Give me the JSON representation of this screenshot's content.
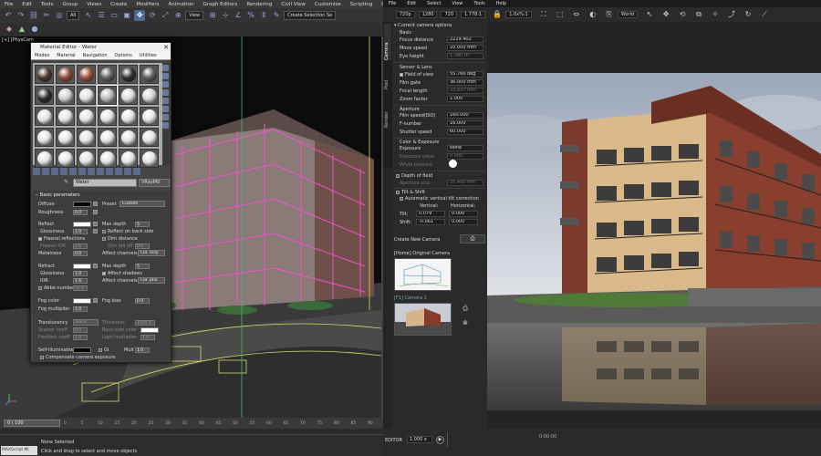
{
  "max": {
    "menu": [
      "File",
      "Edit",
      "Tools",
      "Group",
      "Views",
      "Create",
      "Modifiers",
      "Animation",
      "Graph Editors",
      "Rendering",
      "Civil View",
      "Customize",
      "Scripting",
      "Interactive"
    ],
    "toolbar": {
      "filter": "All",
      "ref_coord": "View",
      "selection_set": "Create Selection Se"
    },
    "viewport_label": "[+] [PhysCam",
    "timeline": {
      "frame": "0 / 100"
    },
    "ticks": [
      "0",
      "5",
      "10",
      "15",
      "20",
      "25",
      "30",
      "35",
      "40",
      "45",
      "50",
      "55",
      "60",
      "65",
      "70",
      "75",
      "80",
      "85",
      "90"
    ],
    "status": {
      "script": "MAXScript Mi",
      "selection": "None Selected",
      "hint": "Click and drag to select and move objects"
    }
  },
  "material_editor": {
    "title": "Material Editor - Water",
    "menu": [
      "Modes",
      "Material",
      "Navigation",
      "Options",
      "Utilities"
    ],
    "name": "Water",
    "type": "VRayMtl",
    "rollout": "Basic parameters",
    "labels": {
      "diffuse": "Diffuse",
      "roughness": "Roughness",
      "preset": "Preset",
      "preset_value": "Custom",
      "reflect": "Reflect",
      "glossiness": "Glossiness",
      "fresnel": "Fresnel reflections",
      "fresnel_ior": "Fresnel IOR",
      "metalness": "Metalness",
      "max_depth": "Max depth",
      "reflect_back": "Reflect on back side",
      "dim_distance": "Dim distance",
      "dim_falloff": "Dim fall off",
      "affect_channels": "Affect channels",
      "refract": "Refract",
      "ior": "IOR",
      "abbe": "Abbe number",
      "affect_shadows": "Affect shadows",
      "fog_color": "Fog color",
      "fog_bias": "Fog bias",
      "fog_mult": "Fog multiplier",
      "translucency": "Translucency",
      "translucency_value": "None",
      "scatter_coeff": "Scatter coeff",
      "fwd_bck": "Fwd/bck coeff",
      "thickness": "Thickness",
      "back_side_color": "Back-side color",
      "light_mult": "Light multiplier",
      "self_illum": "Self-illumination",
      "gi": "GI",
      "mult": "Mult",
      "compensate": "Compensate camera exposure"
    },
    "values": {
      "roughness": "0.0",
      "reflect_gloss": "1.0",
      "fresnel_ior": "1.6",
      "metalness": "0.0",
      "max_depth": "5",
      "dim_falloff": "0.0",
      "affect_channels": "Col. only",
      "refract_gloss": "1.0",
      "ior": "1.6",
      "abbe": "50.0",
      "refract_max_depth": "5",
      "affect_channels2": "Col. pha",
      "fog_bias": "0.0",
      "fog_mult": "1.0",
      "scatter": "0.0",
      "fwdbck": "1.0",
      "thickness": "1000.0",
      "light_mult": "1.0",
      "mult": "1.0"
    }
  },
  "vfb": {
    "menu": [
      "File",
      "Edit",
      "Select",
      "View",
      "Tools",
      "Help"
    ],
    "toolbar": {
      "res": "720p",
      "w": "1280",
      "h": "720",
      "aspect": "1.778:1",
      "zoom": "1.0x%:1",
      "space": "World"
    },
    "tabs": [
      "Camera",
      "Post",
      "Render"
    ],
    "panel": {
      "current": "Current camera options",
      "basic": "Basic",
      "focus_distance": {
        "label": "Focus distance",
        "value": "2229.402"
      },
      "move_speed": {
        "label": "Move speed",
        "value": "10.000 mm"
      },
      "eye_height": {
        "label": "Eye height",
        "value": "1.380 m"
      },
      "sensor": "Sensor & Lens",
      "fov": {
        "label": "Field of view",
        "value": "55.766 deg"
      },
      "film_gate": {
        "label": "Film gate",
        "value": "36.000 mm"
      },
      "focal_length": {
        "label": "Focal length",
        "value": "33.837 mm"
      },
      "zoom_factor": {
        "label": "Zoom factor",
        "value": "1.000"
      },
      "aperture": "Aperture",
      "film_speed": {
        "label": "Film speed(ISO)",
        "value": "160.000"
      },
      "fnumber": {
        "label": "F-number",
        "value": "16.000"
      },
      "shutter": {
        "label": "Shutter speed",
        "value": "60.000"
      },
      "color_exposure": "Color & Exposure",
      "exposure": {
        "label": "Exposure",
        "value": "None"
      },
      "exposure_value": {
        "label": "Exposure value",
        "value": "0.000"
      },
      "white_balance": {
        "label": "White balance"
      },
      "dof": "Depth of field",
      "aperture_size": {
        "label": "Aperture size",
        "value": "25.400 mm"
      },
      "tilt_shift": "Tilt & Shift",
      "auto_tilt": "Automatic vertical tilt correction",
      "vertical": "Vertical:",
      "horizontal": "Horizontal:",
      "tilt": {
        "label": "Tilt:",
        "v": "0.079",
        "h": "0.000"
      },
      "shift": {
        "label": "Shift:",
        "v": "-0.061",
        "h": "0.000"
      },
      "create_new_camera": "Create New Camera",
      "cameras": [
        "[Home] Original Camera",
        "[F1] Camera 1"
      ]
    },
    "bottom": {
      "editor": "EDITOR",
      "zoom": "1.000 x",
      "time": "0:00:00"
    }
  }
}
